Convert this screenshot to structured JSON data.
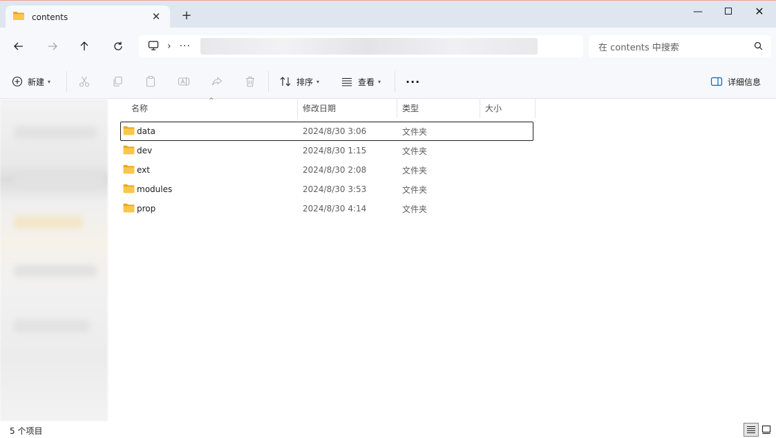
{
  "window": {
    "tab_title": "contents",
    "new_tab": "+",
    "close_tab": "✕",
    "minimize": "—",
    "close": "✕"
  },
  "nav": {
    "more": "···",
    "search_placeholder": "在 contents 中搜索"
  },
  "toolbar": {
    "new_label": "新建",
    "sort_label": "排序",
    "view_label": "查看",
    "more": "···",
    "details_label": "详细信息"
  },
  "columns": {
    "name": "名称",
    "date": "修改日期",
    "type": "类型",
    "size": "大小"
  },
  "files": [
    {
      "name": "data",
      "date": "2024/8/30 3:06",
      "type": "文件夹",
      "size": ""
    },
    {
      "name": "dev",
      "date": "2024/8/30 1:15",
      "type": "文件夹",
      "size": ""
    },
    {
      "name": "ext",
      "date": "2024/8/30 2:08",
      "type": "文件夹",
      "size": ""
    },
    {
      "name": "modules",
      "date": "2024/8/30 3:53",
      "type": "文件夹",
      "size": ""
    },
    {
      "name": "prop",
      "date": "2024/8/30 4:14",
      "type": "文件夹",
      "size": ""
    }
  ],
  "status": {
    "item_count": "5 个项目"
  },
  "colors": {
    "folder": "#f8c74c",
    "folder_dark": "#e9a825",
    "accent": "#0067c0",
    "tabbar_bg": "#dfe6f0"
  }
}
